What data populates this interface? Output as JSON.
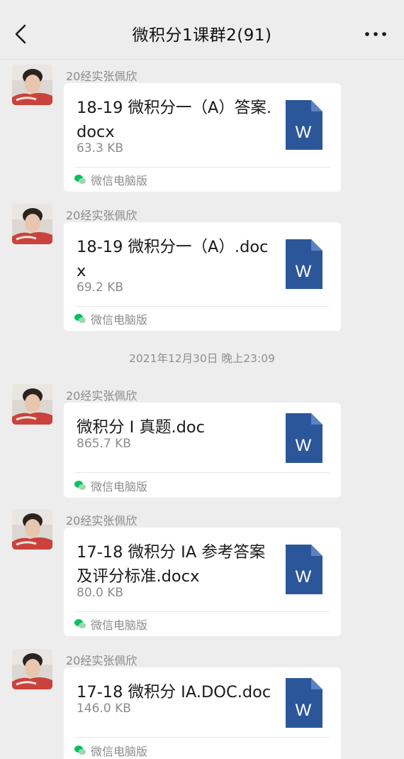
{
  "header": {
    "back_icon": "chevron-left-icon",
    "title": "微积分1课群2(91)",
    "more_icon": "more-dots-icon"
  },
  "timestamp": "2021年12月30日 晚上23:09",
  "messages": [
    {
      "sender": "20经实张佩欣",
      "file_name": "18-19 微积分一（A）答案.docx",
      "file_size": "63.3 KB",
      "source": "微信电脑版",
      "file_icon": "word-document-icon"
    },
    {
      "sender": "20经实张佩欣",
      "file_name": "18-19 微积分一（A）.docx",
      "file_size": "69.2 KB",
      "source": "微信电脑版",
      "file_icon": "word-document-icon"
    },
    {
      "sender": "20经实张佩欣",
      "file_name": "微积分 I 真题.doc",
      "file_size": "865.7 KB",
      "source": "微信电脑版",
      "file_icon": "word-document-icon"
    },
    {
      "sender": "20经实张佩欣",
      "file_name": "17-18 微积分 IA 参考答案及评分标准.docx",
      "file_size": "80.0 KB",
      "source": "微信电脑版",
      "file_icon": "word-document-icon"
    },
    {
      "sender": "20经实张佩欣",
      "file_name": "17-18 微积分 IA.DOC.doc",
      "file_size": "146.0 KB",
      "source": "微信电脑版",
      "file_icon": "word-document-icon"
    }
  ],
  "colors": {
    "background": "#ededed",
    "card": "#ffffff",
    "word_blue": "#2b579a",
    "wechat_green": "#07c160"
  }
}
